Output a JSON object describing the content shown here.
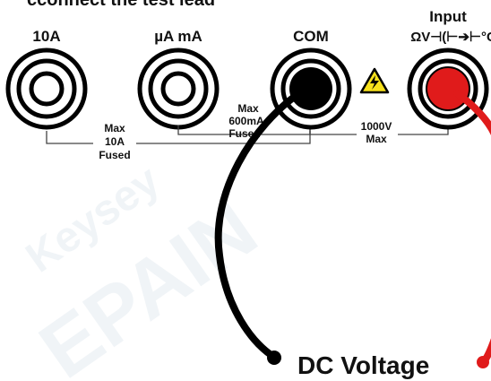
{
  "header_fragment": "cconnect the test lead",
  "terminals": [
    {
      "label": "10A",
      "plug": null
    },
    {
      "label": "µA mA",
      "plug": null
    },
    {
      "label": "COM",
      "plug": "black"
    },
    {
      "label": "Input",
      "sublabel": "ΩV⊣(⊢➔⊢°C",
      "plug": "red"
    }
  ],
  "ratings": {
    "left": [
      "Max",
      "10A",
      "Fused"
    ],
    "middle": [
      "Max",
      "600mA",
      "Fused"
    ],
    "right": [
      "1000V",
      "Max"
    ]
  },
  "warning_icon": "high-voltage-warning-icon",
  "measurement_label": "DC Voltage",
  "watermark": [
    "Keysey",
    "EPAIN"
  ],
  "colors": {
    "com_lead": "#000000",
    "input_lead": "#e01b1b",
    "warning_fill": "#f7e11c"
  }
}
